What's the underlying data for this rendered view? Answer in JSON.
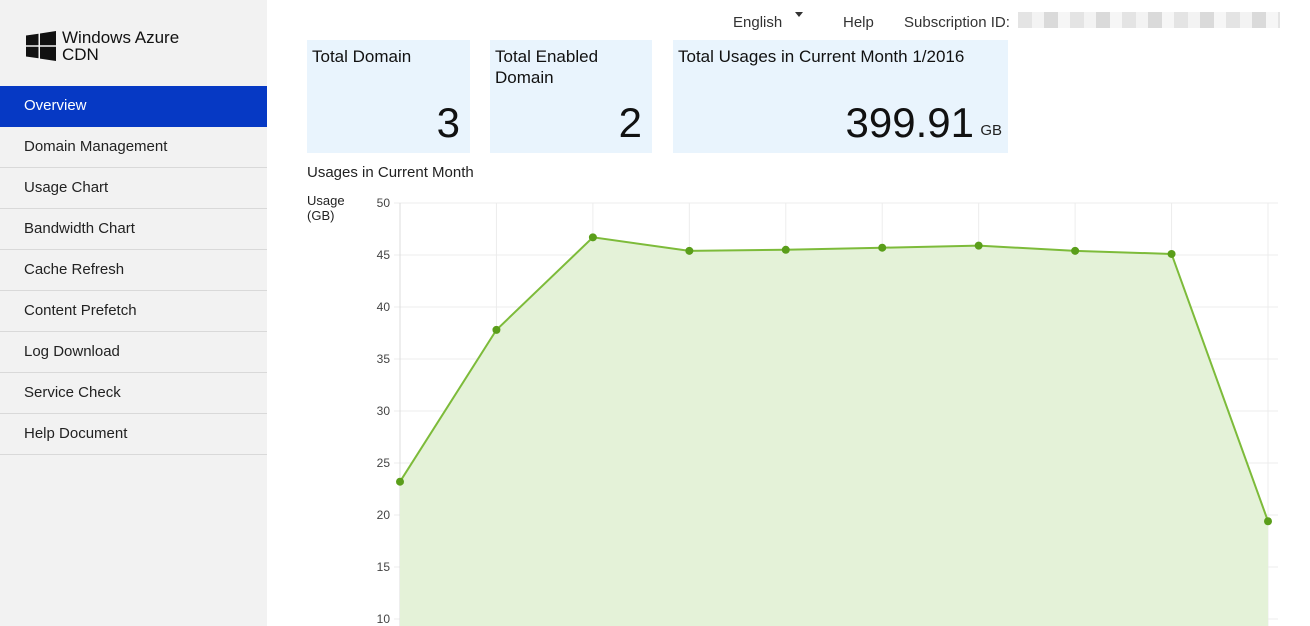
{
  "brand": {
    "line1": "Windows Azure",
    "line2": "CDN",
    "logo_icon": "windows-logo-icon"
  },
  "nav": {
    "items": [
      {
        "label": "Overview",
        "active": true
      },
      {
        "label": "Domain Management"
      },
      {
        "label": "Usage Chart"
      },
      {
        "label": "Bandwidth Chart"
      },
      {
        "label": "Cache Refresh"
      },
      {
        "label": "Content Prefetch"
      },
      {
        "label": "Log Download"
      },
      {
        "label": "Service Check"
      },
      {
        "label": "Help Document"
      }
    ],
    "active_color": "#0639c4"
  },
  "topbar": {
    "language": "English",
    "language_caret_icon": "caret-down-icon",
    "help": "Help",
    "subscription_label": "Subscription ID:"
  },
  "cards": {
    "total_domain": {
      "title": "Total Domain",
      "value": "3"
    },
    "total_enabled": {
      "title": "Total Enabled Domain",
      "value": "2"
    },
    "total_usage": {
      "title": "Total Usages in Current Month 1/2016",
      "value": "399.91",
      "unit": "GB"
    }
  },
  "chart": {
    "title": "Usages in Current Month",
    "ylabel_line1": "Usage",
    "ylabel_line2": "(GB)"
  },
  "chart_data": {
    "type": "area",
    "title": "Usages in Current Month",
    "ylabel": "Usage (GB)",
    "xlabel": "",
    "ylim": [
      10,
      50
    ],
    "yticks": [
      10,
      15,
      20,
      25,
      30,
      35,
      40,
      45,
      50
    ],
    "grid": true,
    "line_color": "#7dbb3a",
    "point_color": "#5a9e1a",
    "fill_color": "#e4f2d8",
    "series": [
      {
        "values": [
          23.2,
          37.8,
          46.7,
          45.4,
          45.5,
          45.7,
          45.9,
          45.4,
          45.1,
          19.4
        ]
      }
    ]
  }
}
